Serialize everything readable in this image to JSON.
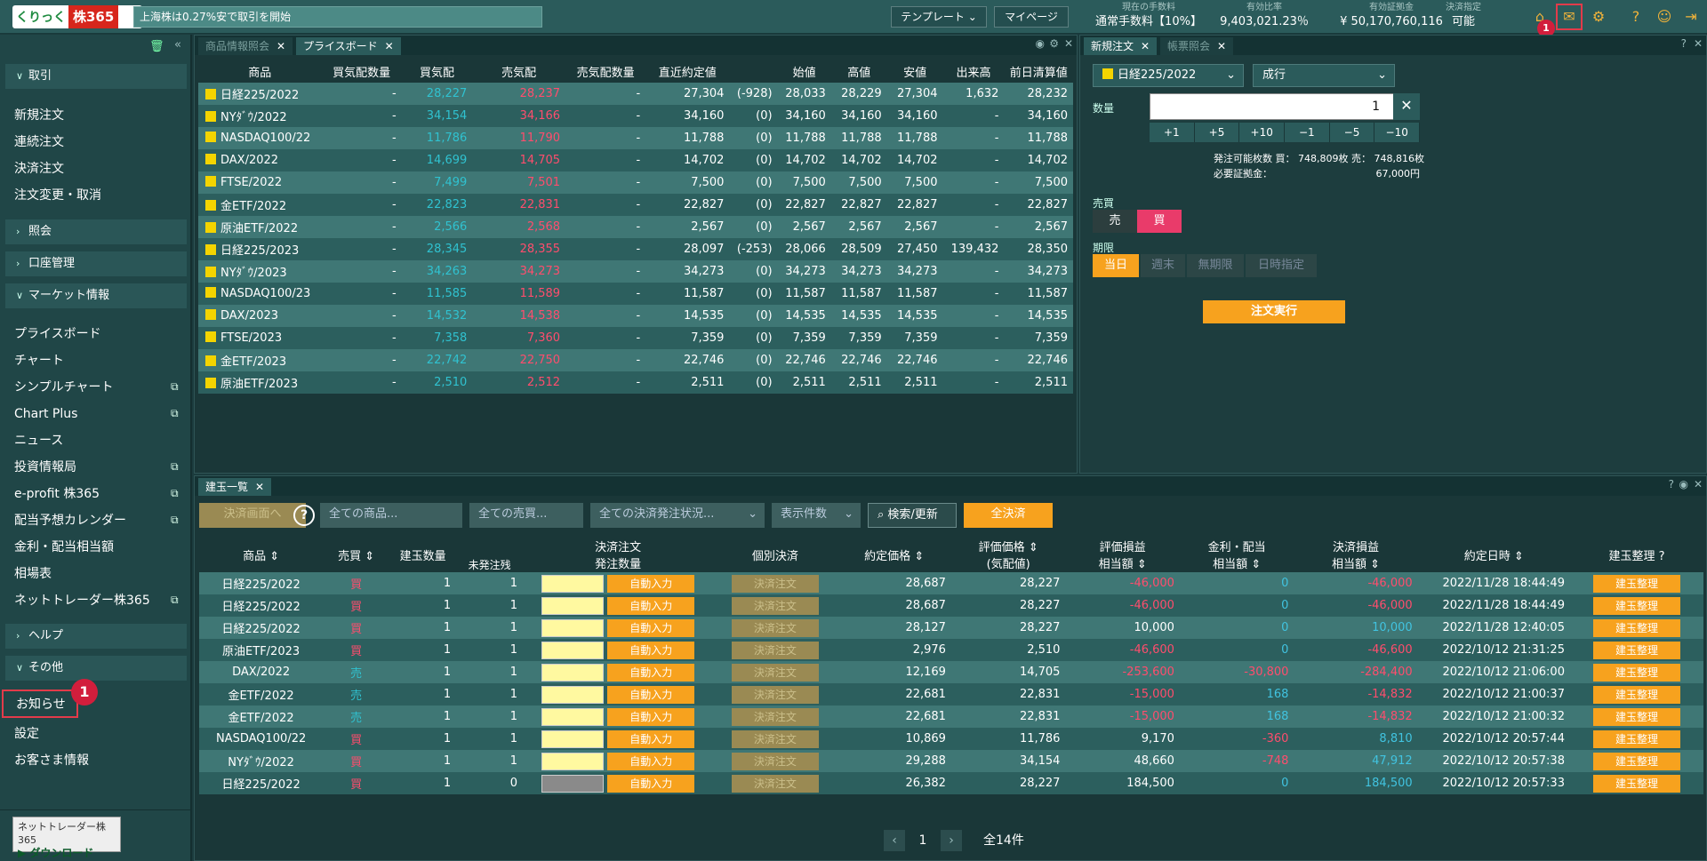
{
  "header": {
    "logo_left": "くりっく",
    "logo_right": "株365",
    "ticker": "上海株は0.27%安で取引を開始",
    "template_label": "テンプレート",
    "mypage_label": "マイページ",
    "stats": [
      {
        "label": "現在の手数料",
        "value": "通常手数料【10%】"
      },
      {
        "label": "有効比率",
        "value": "9,403,021.23％"
      },
      {
        "label": "有効証拠金",
        "value": "¥ 50,170,760,116"
      },
      {
        "label": "決済指定",
        "value": "可能"
      }
    ],
    "mail_badge": "1"
  },
  "sidebar": {
    "sections": {
      "torihiki": "取引",
      "shoukai": "照会",
      "koza": "口座管理",
      "market": "マーケット情報",
      "help": "ヘルプ",
      "other": "その他"
    },
    "trade_items": [
      "新規注文",
      "連続注文",
      "決済注文",
      "注文変更・取消"
    ],
    "market_items": [
      "プライスボード",
      "チャート",
      "シンプルチャート",
      "Chart Plus",
      "ニュース",
      "投資情報局",
      "e-profit 株365",
      "配当予想カレンダー",
      "金利・配当相当額",
      "相場表",
      "ネットトレーダー株365"
    ],
    "other_items": [
      "お知らせ",
      "設定",
      "お客さま情報"
    ],
    "notice_badge": "1",
    "download_title": "ネットトレーダー株365",
    "download_label": "ダウンロード"
  },
  "price_panel": {
    "tabs": [
      "商品情報照会",
      "プライスボード"
    ],
    "headers": [
      "商品",
      "買気配数量",
      "買気配",
      "売気配",
      "売気配数量",
      "直近約定値",
      "",
      "始値",
      "高値",
      "安値",
      "出来高",
      "前日清算値"
    ],
    "rows": [
      [
        "日経225/2022",
        "-",
        "28,227",
        "28,237",
        "-",
        "27,304",
        "(-928)",
        "28,033",
        "28,229",
        "27,304",
        "1,632",
        "28,232"
      ],
      [
        "NYﾀﾞｳ/2022",
        "-",
        "34,154",
        "34,166",
        "-",
        "34,160",
        "(0)",
        "34,160",
        "34,160",
        "34,160",
        "-",
        "34,160"
      ],
      [
        "NASDAQ100/22",
        "-",
        "11,786",
        "11,790",
        "-",
        "11,788",
        "(0)",
        "11,788",
        "11,788",
        "11,788",
        "-",
        "11,788"
      ],
      [
        "DAX/2022",
        "-",
        "14,699",
        "14,705",
        "-",
        "14,702",
        "(0)",
        "14,702",
        "14,702",
        "14,702",
        "-",
        "14,702"
      ],
      [
        "FTSE/2022",
        "-",
        "7,499",
        "7,501",
        "-",
        "7,500",
        "(0)",
        "7,500",
        "7,500",
        "7,500",
        "-",
        "7,500"
      ],
      [
        "金ETF/2022",
        "-",
        "22,823",
        "22,831",
        "-",
        "22,827",
        "(0)",
        "22,827",
        "22,827",
        "22,827",
        "-",
        "22,827"
      ],
      [
        "原油ETF/2022",
        "-",
        "2,566",
        "2,568",
        "-",
        "2,567",
        "(0)",
        "2,567",
        "2,567",
        "2,567",
        "-",
        "2,567"
      ],
      [
        "日経225/2023",
        "-",
        "28,345",
        "28,355",
        "-",
        "28,097",
        "(-253)",
        "28,066",
        "28,509",
        "27,450",
        "139,432",
        "28,350"
      ],
      [
        "NYﾀﾞｳ/2023",
        "-",
        "34,263",
        "34,273",
        "-",
        "34,273",
        "(0)",
        "34,273",
        "34,273",
        "34,273",
        "-",
        "34,273"
      ],
      [
        "NASDAQ100/23",
        "-",
        "11,585",
        "11,589",
        "-",
        "11,587",
        "(0)",
        "11,587",
        "11,587",
        "11,587",
        "-",
        "11,587"
      ],
      [
        "DAX/2023",
        "-",
        "14,532",
        "14,538",
        "-",
        "14,535",
        "(0)",
        "14,535",
        "14,535",
        "14,535",
        "-",
        "14,535"
      ],
      [
        "FTSE/2023",
        "-",
        "7,358",
        "7,360",
        "-",
        "7,359",
        "(0)",
        "7,359",
        "7,359",
        "7,359",
        "-",
        "7,359"
      ],
      [
        "金ETF/2023",
        "-",
        "22,742",
        "22,750",
        "-",
        "22,746",
        "(0)",
        "22,746",
        "22,746",
        "22,746",
        "-",
        "22,746"
      ],
      [
        "原油ETF/2023",
        "-",
        "2,510",
        "2,512",
        "-",
        "2,511",
        "(0)",
        "2,511",
        "2,511",
        "2,511",
        "-",
        "2,511"
      ]
    ]
  },
  "order_panel": {
    "tabs": [
      "新規注文",
      "帳票照会"
    ],
    "symbol": "日経225/2022",
    "order_type": "成行",
    "qty_label": "数量",
    "qty_value": "1",
    "steps": [
      "+1",
      "+5",
      "+10",
      "−1",
      "−5",
      "−10"
    ],
    "avail_line": "発注可能枚数 買： 748,809枚 売： 748,816枚",
    "margin_label": "必要証拠金：",
    "margin_value": "67,000円",
    "side_label": "売買",
    "sell": "売",
    "buy": "買",
    "period_label": "期限",
    "periods": [
      "当日",
      "週末",
      "無期限",
      "日時指定"
    ],
    "exec_label": "注文実行"
  },
  "positions": {
    "tab": "建玉一覧",
    "settle_btn": "決済画面へ",
    "product_filter": "全ての商品...",
    "side_filter": "全ての売買...",
    "status_filter": "全ての決済発注状況...",
    "count_filter": "表示件数",
    "search_btn": "検索/更新",
    "all_settle": "全決済",
    "headers": {
      "product": "商品",
      "side": "売買",
      "qty": "建玉数量",
      "unfilled": "未発注残",
      "settle": "決済注文",
      "order_qty": "発注数量",
      "indiv": "個別決済",
      "contract": "約定価格",
      "eval1": "評価価格",
      "eval2": "(気配値)",
      "pl1": "評価損益",
      "pl2": "相当額",
      "int1": "金利・配当",
      "int2": "相当額",
      "spl1": "決済損益",
      "spl2": "相当額",
      "date": "約定日時",
      "organize": "建玉整理"
    },
    "auto_label": "自動入力",
    "settle_label": "決済注文",
    "organize_label": "建玉整理",
    "rows": [
      {
        "p": "日経225/2022",
        "s": "買",
        "q": "1",
        "u": "1",
        "c": "28,687",
        "e": "28,227",
        "pl": "-46,000",
        "i": "0",
        "sp": "-46,000",
        "d": "2022/11/28 18:44:49"
      },
      {
        "p": "日経225/2022",
        "s": "買",
        "q": "1",
        "u": "1",
        "c": "28,687",
        "e": "28,227",
        "pl": "-46,000",
        "i": "0",
        "sp": "-46,000",
        "d": "2022/11/28 18:44:49"
      },
      {
        "p": "日経225/2022",
        "s": "買",
        "q": "1",
        "u": "1",
        "c": "28,127",
        "e": "28,227",
        "pl": "10,000",
        "i": "0",
        "sp": "10,000",
        "d": "2022/11/28 12:40:05"
      },
      {
        "p": "原油ETF/2023",
        "s": "買",
        "q": "1",
        "u": "1",
        "c": "2,976",
        "e": "2,510",
        "pl": "-46,600",
        "i": "0",
        "sp": "-46,600",
        "d": "2022/10/12 21:31:25"
      },
      {
        "p": "DAX/2022",
        "s": "売",
        "q": "1",
        "u": "1",
        "c": "12,169",
        "e": "14,705",
        "pl": "-253,600",
        "i": "-30,800",
        "sp": "-284,400",
        "d": "2022/10/12 21:06:00"
      },
      {
        "p": "金ETF/2022",
        "s": "売",
        "q": "1",
        "u": "1",
        "c": "22,681",
        "e": "22,831",
        "pl": "-15,000",
        "i": "168",
        "sp": "-14,832",
        "d": "2022/10/12 21:00:37"
      },
      {
        "p": "金ETF/2022",
        "s": "売",
        "q": "1",
        "u": "1",
        "c": "22,681",
        "e": "22,831",
        "pl": "-15,000",
        "i": "168",
        "sp": "-14,832",
        "d": "2022/10/12 21:00:32"
      },
      {
        "p": "NASDAQ100/22",
        "s": "買",
        "q": "1",
        "u": "1",
        "c": "10,869",
        "e": "11,786",
        "pl": "9,170",
        "i": "-360",
        "sp": "8,810",
        "d": "2022/10/12 20:57:44"
      },
      {
        "p": "NYﾀﾞｳ/2022",
        "s": "買",
        "q": "1",
        "u": "1",
        "c": "29,288",
        "e": "34,154",
        "pl": "48,660",
        "i": "-748",
        "sp": "47,912",
        "d": "2022/10/12 20:57:38"
      },
      {
        "p": "日経225/2022",
        "s": "買",
        "q": "1",
        "u": "0",
        "c": "26,382",
        "e": "28,227",
        "pl": "184,500",
        "i": "0",
        "sp": "184,500",
        "d": "2022/10/12 20:57:33"
      }
    ],
    "page": "1",
    "total": "全14件"
  }
}
